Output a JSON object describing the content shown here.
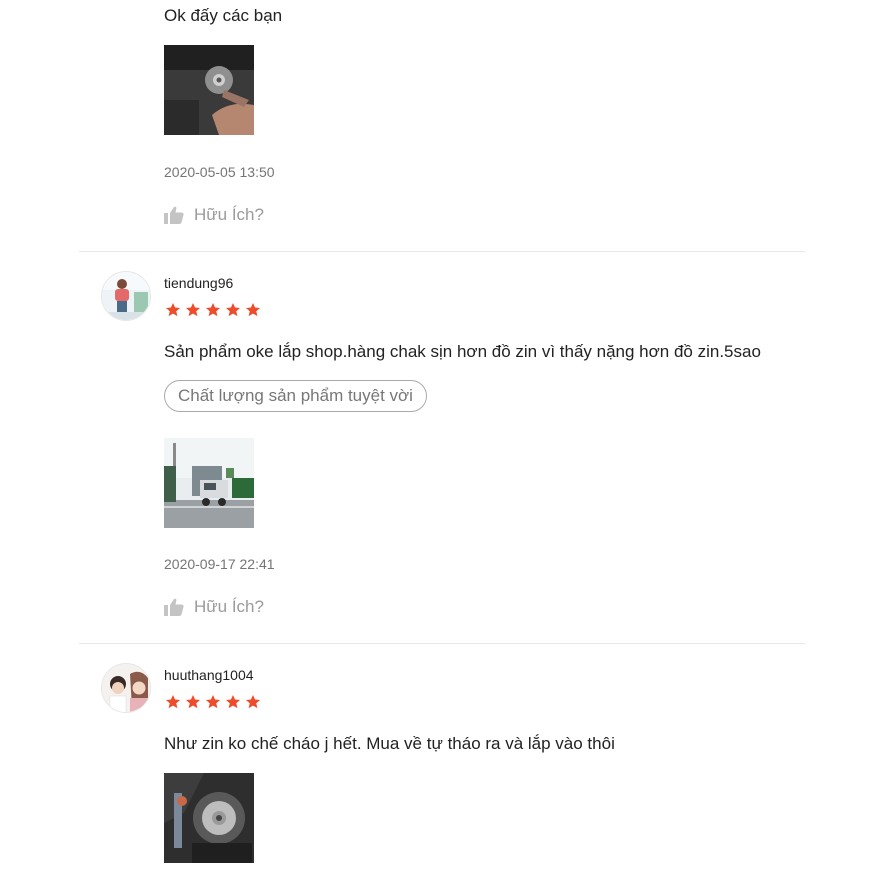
{
  "reviews": [
    {
      "comment": "Ok đấy các bạn",
      "timestamp": "2020-05-05 13:50",
      "helpful_label": "Hữu Ích?"
    },
    {
      "username": "tiendung96",
      "rating": 5,
      "comment": "Sản phẩm oke lắp shop.hàng chak sịn hơn đồ zin vì thấy nặng hơn đồ zin.5sao",
      "tag": "Chất lượng sản phẩm tuyệt vời",
      "timestamp": "2020-09-17 22:41",
      "helpful_label": "Hữu Ích?"
    },
    {
      "username": "huuthang1004",
      "rating": 5,
      "comment": "Như zin ko chế cháo j hết. Mua về tự tháo ra và lắp vào thôi"
    }
  ],
  "colors": {
    "star": "#ee4d2d",
    "divider": "#e8e8e8",
    "muted_text": "#757575",
    "helpful_text": "#9b9b9b",
    "icon": "#c4c4c4"
  },
  "icons": {
    "star": "star-icon",
    "helpful": "thumbs-up-icon"
  }
}
